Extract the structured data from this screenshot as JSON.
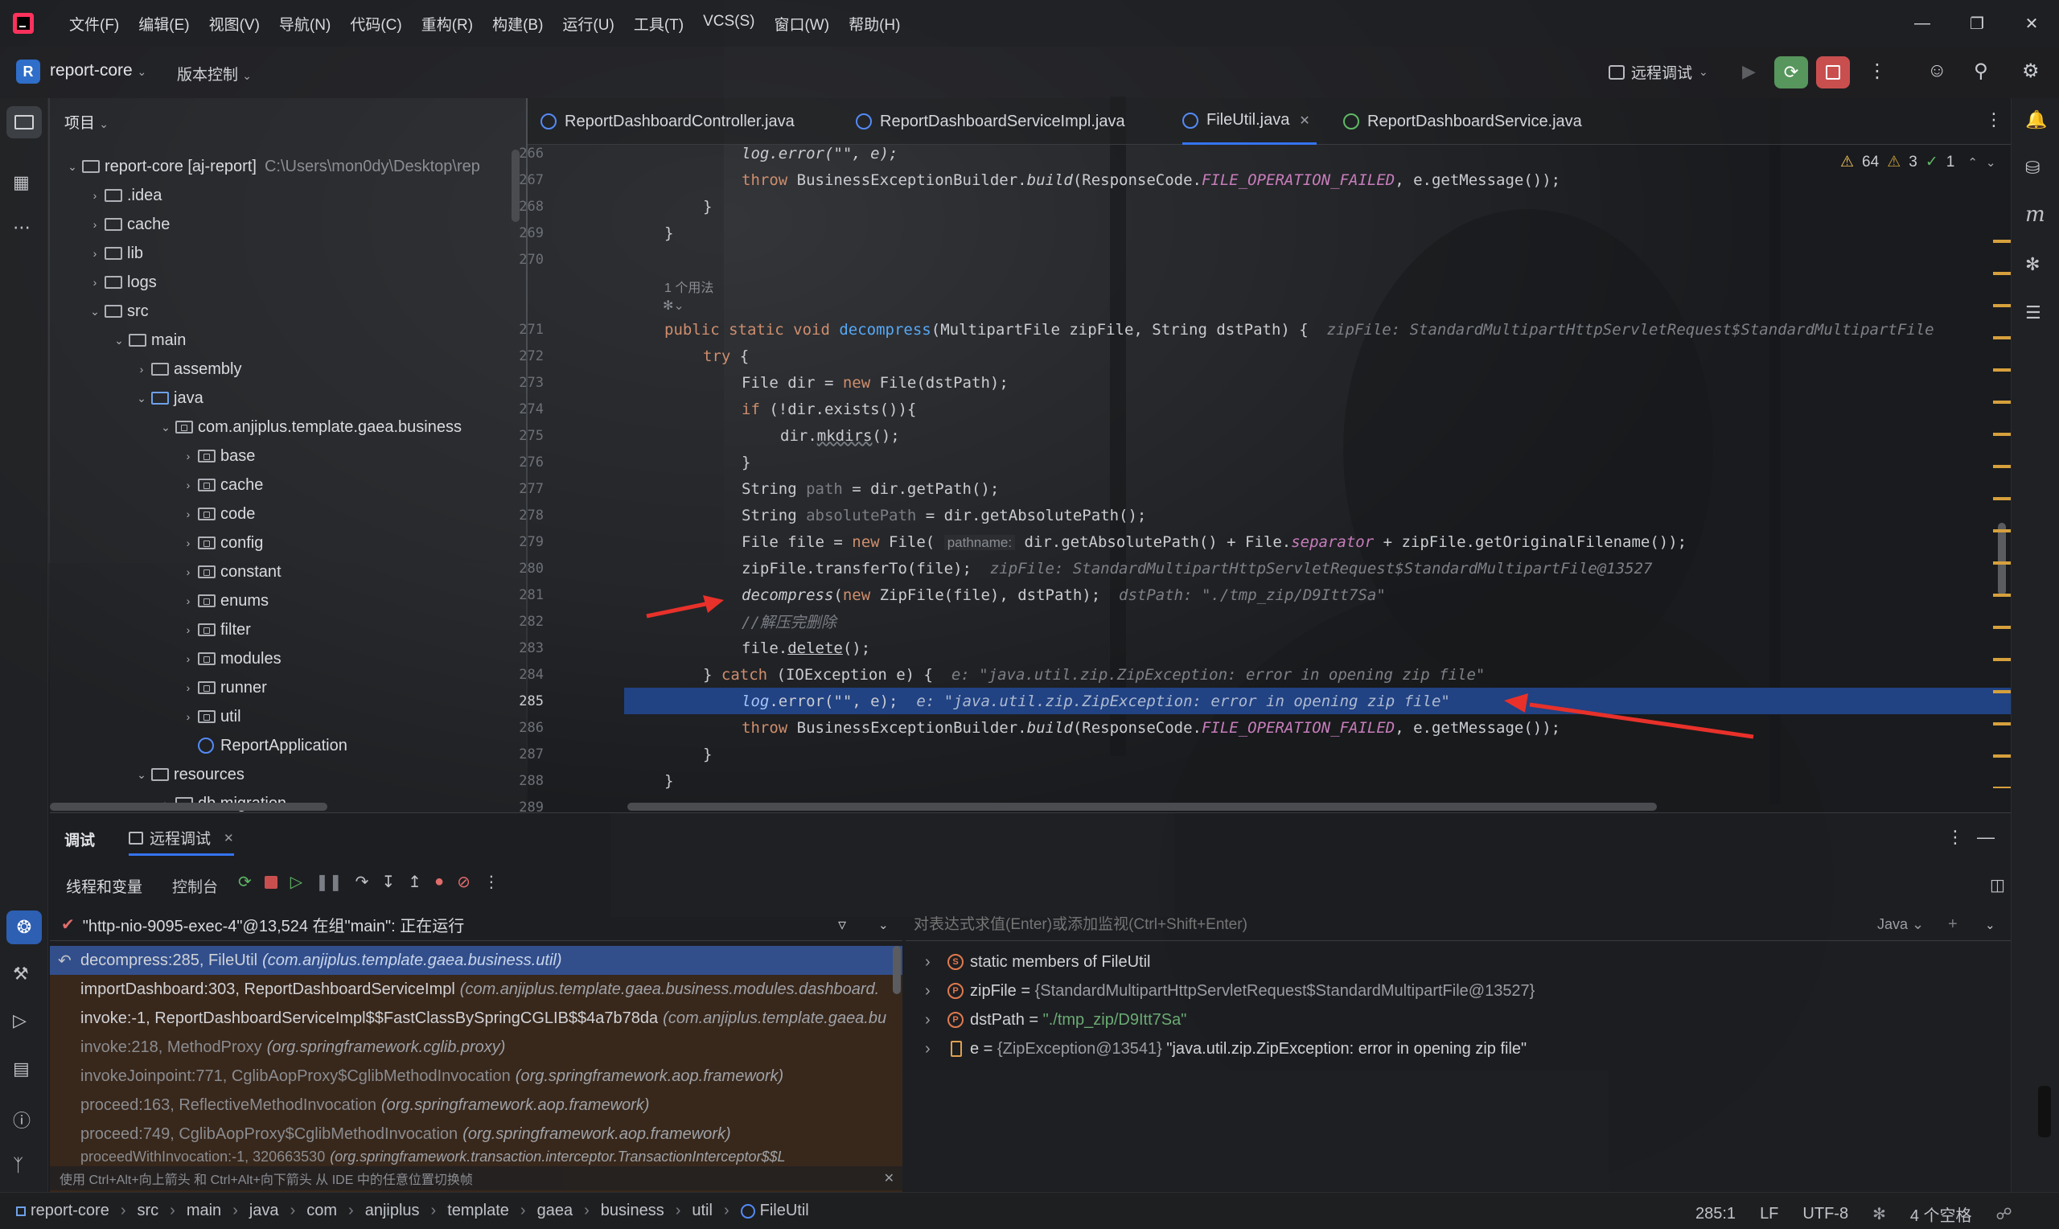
{
  "title_bar": {
    "menu": [
      "文件(F)",
      "编辑(E)",
      "视图(V)",
      "导航(N)",
      "代码(C)",
      "重构(R)",
      "构建(B)",
      "运行(U)",
      "工具(T)",
      "VCS(S)",
      "窗口(W)",
      "帮助(H)"
    ]
  },
  "toolbar": {
    "project_letter": "R",
    "project_name": "report-core",
    "vcs": "版本控制",
    "run_config": "远程调试"
  },
  "project_panel": {
    "title": "项目",
    "root_name": "report-core [aj-report]",
    "root_path": "C:\\Users\\mon0dy\\Desktop\\rep",
    "items": [
      ".idea",
      "cache",
      "lib",
      "logs",
      "src",
      "main",
      "assembly",
      "java",
      "com.anjiplus.template.gaea.business",
      "base",
      "cache",
      "code",
      "config",
      "constant",
      "enums",
      "filter",
      "modules",
      "runner",
      "util",
      "ReportApplication",
      "resources",
      "db.migration"
    ]
  },
  "editor": {
    "tabs": [
      "ReportDashboardController.java",
      "ReportDashboardServiceImpl.java",
      "FileUtil.java",
      "ReportDashboardService.java"
    ],
    "inspections": {
      "warnings": "64",
      "weak_warnings": "3",
      "ok": "1"
    },
    "usage_hint": "1 个用法",
    "line_numbers": [
      "266",
      "267",
      "268",
      "269",
      "270",
      "271",
      "272",
      "273",
      "274",
      "275",
      "276",
      "277",
      "278",
      "279",
      "280",
      "281",
      "282",
      "283",
      "284",
      "285",
      "286",
      "287",
      "288",
      "289"
    ],
    "code": {
      "l266": "log.error(\"\", e);",
      "l267a": "throw",
      "l267b": " BusinessExceptionBuilder.",
      "l267c": "build",
      "l267d": "(ResponseCode.",
      "l267e": "FILE_OPERATION_FAILED",
      "l267f": ", e.getMessage());",
      "l268": "}",
      "l269": "}",
      "l271a": "public static void",
      "l271b": "decompress",
      "l271c": "(MultipartFile zipFile, String dstPath) {",
      "l271d": "zipFile: StandardMultipartHttpServletRequest$StandardMultipartFile",
      "l272a": "try",
      "l272b": " {",
      "l273a": "File dir = ",
      "l273b": "new",
      "l273c": " File(dstPath);",
      "l274a": "if",
      "l274b": " (!dir.exists()){",
      "l275a": "dir.",
      "l275b": "mkdirs",
      "l275c": "();",
      "l276": "}",
      "l277a": "String ",
      "l277b": "path",
      "l277c": " = dir.getPath();",
      "l278a": "String ",
      "l278b": "absolutePath",
      "l278c": " = dir.getAbsolutePath();",
      "l279a": "File file = ",
      "l279b": "new",
      "l279c": " File(",
      "l279d": "pathname:",
      "l279e": " dir.getAbsolutePath() + File.",
      "l279f": "separator",
      "l279g": " + zipFile.getOriginalFilename());",
      "l280a": "zipFile.transferTo(file);",
      "l280b": "zipFile: StandardMultipartHttpServletRequest$StandardMultipartFile@13527",
      "l281a": "decompress",
      "l281b": "(",
      "l281c": "new",
      "l281d": " ZipFile(file), dstPath);",
      "l281e": "dstPath: \"./tmp_zip/D9Itt7Sa\"",
      "l282": "//解压完删除",
      "l283a": "file.",
      "l283b": "delete",
      "l283c": "();",
      "l284a": "} ",
      "l284b": "catch",
      "l284c": " (IOException e) {",
      "l284d": "e: \"java.util.zip.ZipException: error in opening zip file\"",
      "l285a": "log",
      "l285b": ".error(\"\", e);",
      "l285c": "e: \"java.util.zip.ZipException: error in opening zip file\"",
      "l286a": "throw",
      "l286b": " BusinessExceptionBuilder.",
      "l286c": "build",
      "l286d": "(ResponseCode.",
      "l286e": "FILE_OPERATION_FAILED",
      "l286f": ", e.getMessage());",
      "l287": "}",
      "l288": "}"
    }
  },
  "debug": {
    "tab_debug": "调试",
    "tab_session": "远程调试",
    "sub_threads": "线程和变量",
    "sub_console": "控制台",
    "thread": "\"http-nio-9095-exec-4\"@13,524 在组\"main\": 正在运行",
    "eval_placeholder": "对表达式求值(Enter)或添加监视(Ctrl+Shift+Enter)",
    "lang": "Java",
    "frames": [
      {
        "m": "decompress:285, FileUtil",
        "p": "(com.anjiplus.template.gaea.business.util)"
      },
      {
        "m": "importDashboard:303, ReportDashboardServiceImpl",
        "p": "(com.anjiplus.template.gaea.business.modules.dashboard."
      },
      {
        "m": "invoke:-1, ReportDashboardServiceImpl$$FastClassBySpringCGLIB$$4a7b78da",
        "p": "(com.anjiplus.template.gaea.bu"
      },
      {
        "m": "invoke:218, MethodProxy",
        "p": "(org.springframework.cglib.proxy)"
      },
      {
        "m": "invokeJoinpoint:771, CglibAopProxy$CglibMethodInvocation",
        "p": "(org.springframework.aop.framework)"
      },
      {
        "m": "proceed:163, ReflectiveMethodInvocation",
        "p": "(org.springframework.aop.framework)"
      },
      {
        "m": "proceed:749, CglibAopProxy$CglibMethodInvocation",
        "p": "(org.springframework.aop.framework)"
      },
      {
        "m": "proceedWithInvocation:-1, 320663530",
        "p": "(org.springframework.transaction.interceptor.TransactionInterceptor$$L"
      }
    ],
    "frames_hint": "使用 Ctrl+Alt+向上箭头 和 Ctrl+Alt+向下箭头 从 IDE 中的任意位置切换帧",
    "variables": [
      {
        "name": "static members of FileUtil",
        "eq": "",
        "val": ""
      },
      {
        "name": "zipFile",
        "eq": " = ",
        "val": "{StandardMultipartHttpServletRequest$StandardMultipartFile@13527}"
      },
      {
        "name": "dstPath",
        "eq": " = ",
        "val": "\"./tmp_zip/D9Itt7Sa\""
      },
      {
        "name": "e",
        "eq": " = ",
        "val": "{ZipException@13541}",
        "extra": " \"java.util.zip.ZipException: error in opening zip file\""
      }
    ]
  },
  "status_bar": {
    "breadcrumb": [
      "report-core",
      "src",
      "main",
      "java",
      "com",
      "anjiplus",
      "template",
      "gaea",
      "business",
      "util",
      "FileUtil"
    ],
    "position": "285:1",
    "line_sep": "LF",
    "encoding": "UTF-8",
    "indent": "4 个空格"
  }
}
